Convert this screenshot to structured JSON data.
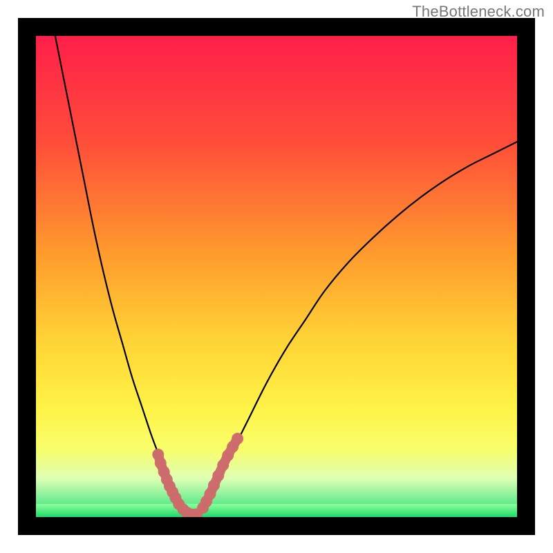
{
  "watermark": "TheBottleneck.com",
  "chart_data": {
    "type": "line",
    "title": "",
    "xlabel": "",
    "ylabel": "",
    "xlim": [
      0,
      100
    ],
    "ylim": [
      0,
      100
    ],
    "grid": false,
    "legend": false,
    "series": [
      {
        "name": "left-curve",
        "x": [
          4,
          6,
          8,
          10,
          12,
          14,
          16,
          18,
          20,
          22,
          24,
          25.5,
          27,
          28,
          29,
          30,
          31,
          31.8
        ],
        "y": [
          100,
          90,
          80,
          70,
          60,
          51,
          43,
          36,
          29,
          23,
          17,
          13,
          9,
          6,
          4,
          2.5,
          1.2,
          0.5
        ]
      },
      {
        "name": "right-curve",
        "x": [
          33.5,
          34.5,
          35.5,
          37,
          39,
          41,
          44,
          48,
          52,
          56,
          60,
          65,
          70,
          75,
          80,
          85,
          90,
          95,
          100
        ],
        "y": [
          0.5,
          1.5,
          3,
          6,
          10,
          14,
          20,
          28,
          35,
          41,
          47,
          53,
          58,
          62.5,
          66.5,
          70,
          73,
          75.5,
          78
        ]
      },
      {
        "name": "bottom-flat",
        "x": [
          31.8,
          32.2,
          32.7,
          33.2,
          33.5
        ],
        "y": [
          0.5,
          0.3,
          0.3,
          0.3,
          0.5
        ]
      }
    ],
    "markers": [
      {
        "name": "left-dot-cluster",
        "color": "#cc6b6b",
        "x": [
          25.4,
          25.9,
          26.6,
          27.2,
          27.8,
          28.4,
          29.0,
          29.7,
          30.6,
          31.4,
          32.1,
          32.8,
          33.4
        ],
        "y": [
          13.0,
          11.2,
          9.4,
          7.8,
          6.4,
          5.2,
          4.0,
          2.7,
          1.6,
          0.9,
          0.6,
          0.5,
          0.6
        ]
      },
      {
        "name": "right-dot-cluster",
        "color": "#cc6b6b",
        "x": [
          34.7,
          35.4,
          36.2,
          37.0,
          37.9,
          38.9,
          39.9,
          40.9,
          41.9
        ],
        "y": [
          1.9,
          3.2,
          4.8,
          6.6,
          8.6,
          10.8,
          12.8,
          14.6,
          16.3
        ]
      }
    ],
    "background_gradient": {
      "stops": [
        {
          "pos": 0.0,
          "color": "#ff1f4a"
        },
        {
          "pos": 0.22,
          "color": "#ff4d3a"
        },
        {
          "pos": 0.45,
          "color": "#ff9a2d"
        },
        {
          "pos": 0.63,
          "color": "#ffd335"
        },
        {
          "pos": 0.78,
          "color": "#fff449"
        },
        {
          "pos": 0.86,
          "color": "#f8ff6c"
        },
        {
          "pos": 0.92,
          "color": "#deffb4"
        },
        {
          "pos": 1.0,
          "color": "#22e07a"
        }
      ]
    },
    "green_band_fraction": 0.028
  }
}
